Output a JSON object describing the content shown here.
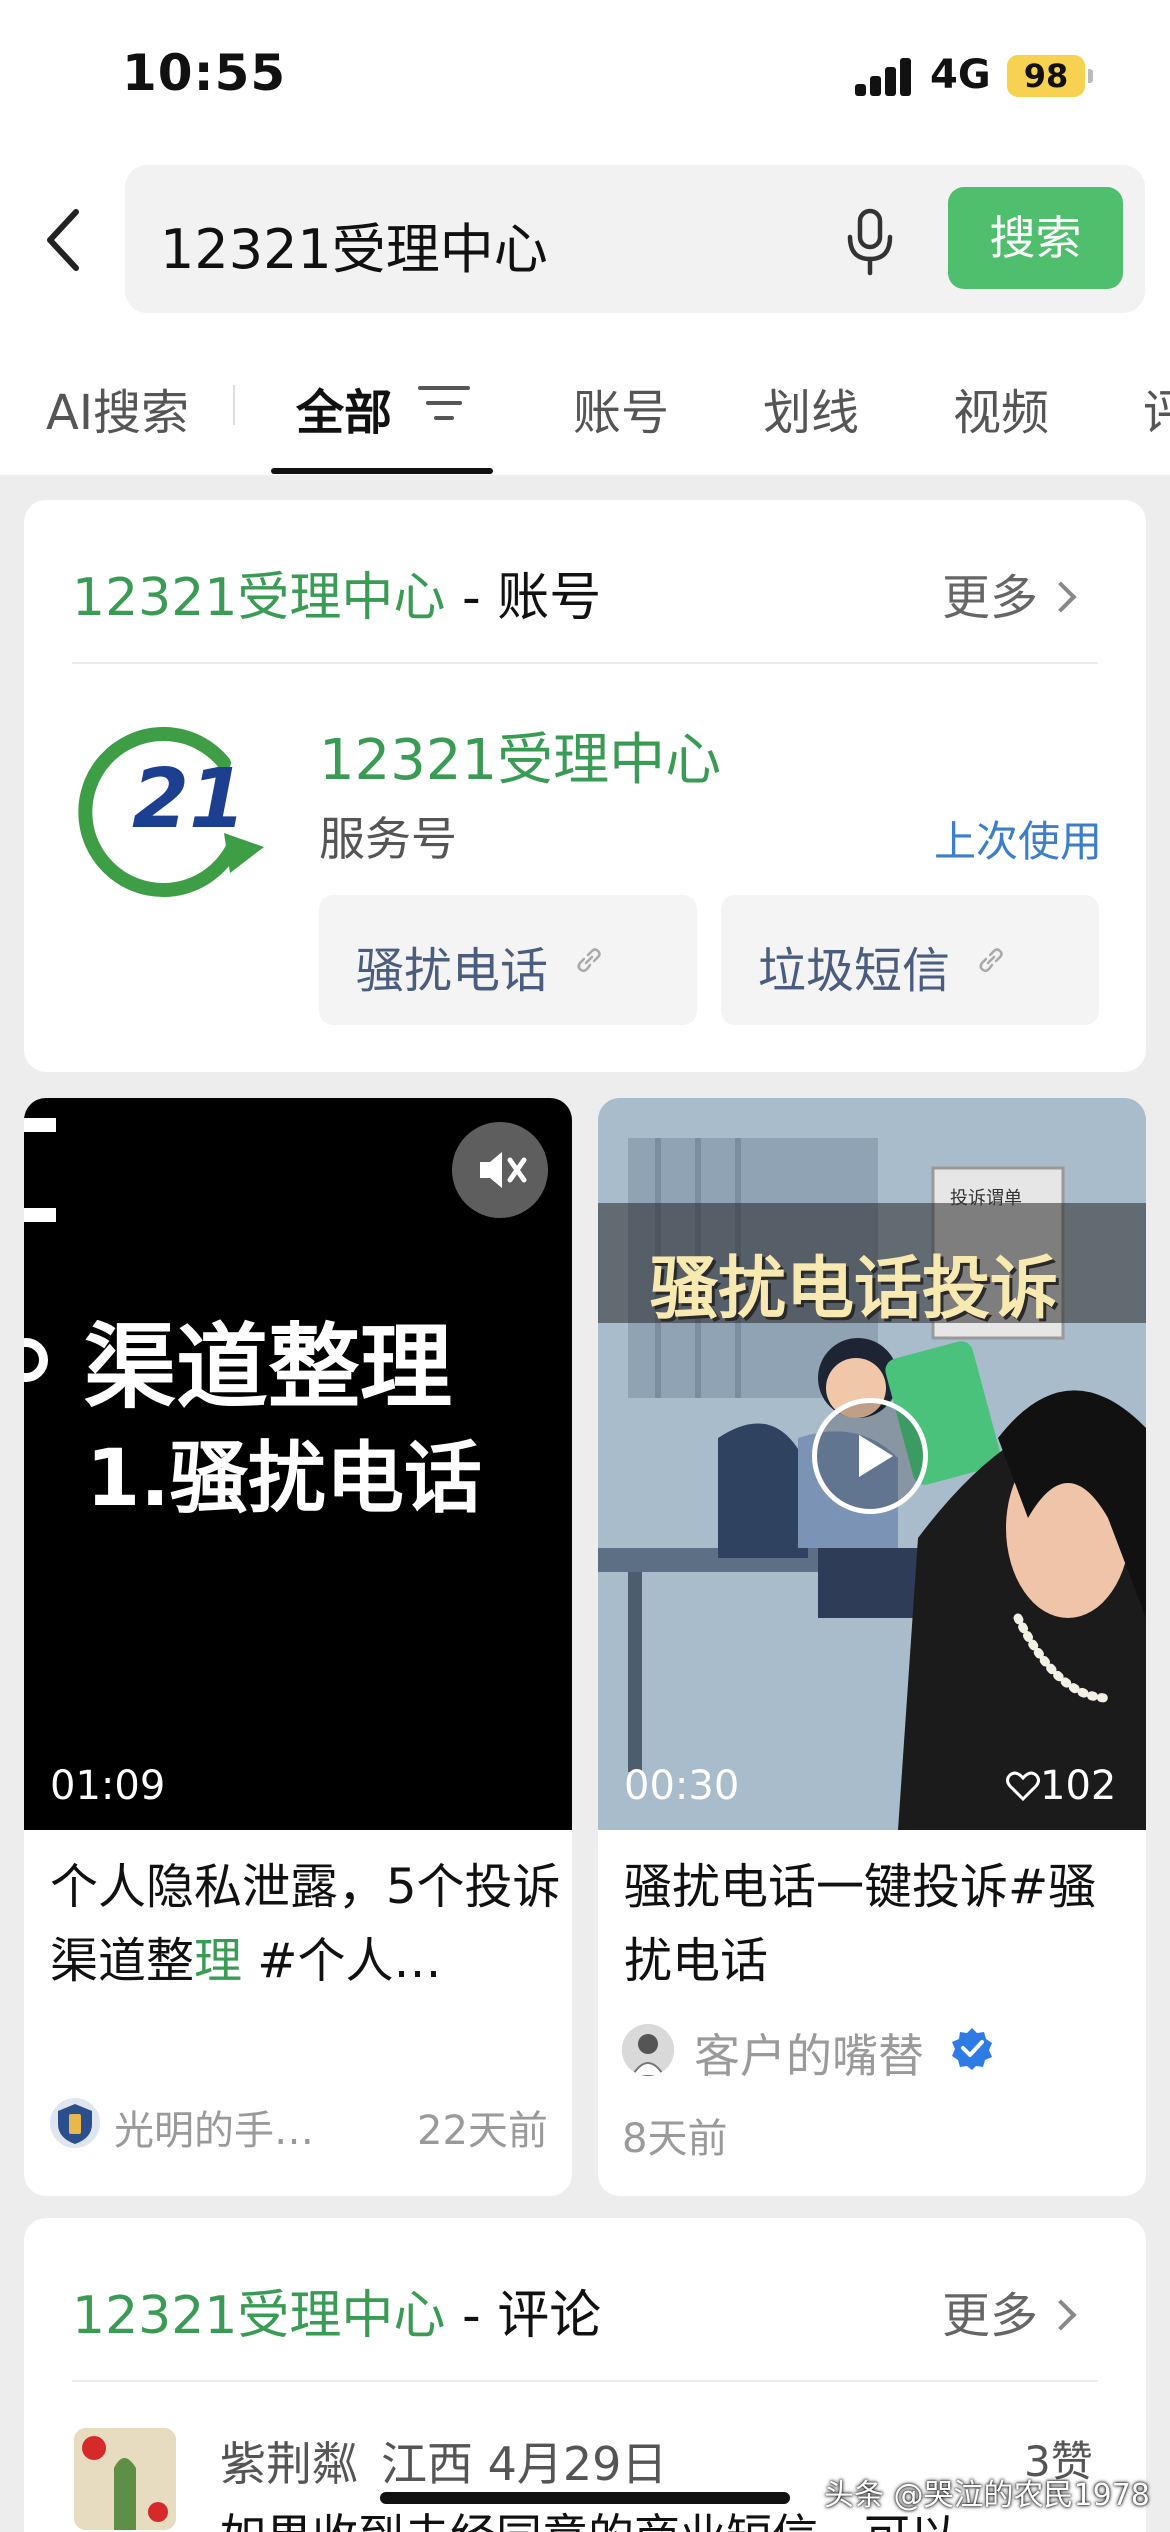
{
  "status_bar": {
    "time": "10:55",
    "network": "4G",
    "battery": "98"
  },
  "search": {
    "query": "12321受理中心",
    "submit_label": "搜索"
  },
  "tabs": [
    {
      "label": "AI搜索"
    },
    {
      "label": "全部"
    },
    {
      "label": "账号"
    },
    {
      "label": "划线"
    },
    {
      "label": "视频"
    },
    {
      "label": "评"
    }
  ],
  "account_section": {
    "title_keyword": "12321受理中心",
    "title_suffix": " - 账号",
    "more_label": "更多",
    "account_name": "12321受理中心",
    "account_type": "服务号",
    "last_used": "上次使用",
    "links": [
      {
        "label": "骚扰电话"
      },
      {
        "label": "垃圾短信"
      }
    ],
    "logo_text": "21"
  },
  "videos": [
    {
      "thumb_line1": "渠道整理",
      "thumb_line2": "1.骚扰电话",
      "duration": "01:09",
      "title_part1": "个人隐私泄露，5个投诉渠道整",
      "title_highlight": "理",
      "title_part2": " #个人…",
      "author": "光明的手…",
      "time_ago": "22天前",
      "muted": true
    },
    {
      "thumb_banner": "骚扰电话投诉",
      "thumb_doc_label": "投诉谓单",
      "duration": "00:30",
      "likes": "102",
      "title": "骚扰电话一键投诉#骚扰电话",
      "author": "客户的嘴替",
      "verified": true,
      "time_ago": "8天前"
    }
  ],
  "comment_section": {
    "title_keyword": "12321受理中心",
    "title_suffix": " - 评论",
    "more_label": "更多",
    "comment_user": "紫荆粼",
    "comment_location_date": "江西 4月29日",
    "comment_likes": "3赞",
    "comment_preview": "如果收到未经同意的商业短信，可以"
  },
  "watermark": "头条 @哭泣的农民1978",
  "colors": {
    "accent_green": "#4fbf6e",
    "highlight_green": "#3a9b55",
    "link_blue": "#3d7ec9",
    "battery_yellow": "#f6d250"
  }
}
